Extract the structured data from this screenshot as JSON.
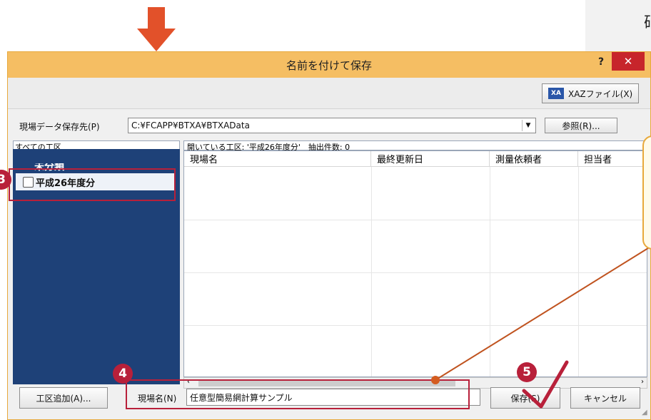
{
  "top_callout_text": "硝",
  "dialog": {
    "title": "名前を付けて保存",
    "help_label": "?",
    "close_label": "✕",
    "xaz_button_label": "XAZファイル(X)",
    "xaz_icon_text": "XA",
    "save_path_label": "現場データ保存先(P)",
    "save_path_value": "C:¥FCAPP¥BTXA¥BTXAData",
    "browse_button_label": "参照(R)...",
    "tree_header": "すべての工区",
    "tree_items": [
      {
        "label": "未分類"
      },
      {
        "label": "平成26年度分"
      }
    ],
    "list_status": "開いている工区: '平成26年度分'　抽出件数: 0",
    "columns": [
      "現場名",
      "最終更新日",
      "測量依頼者",
      "担当者"
    ],
    "add_section_button_label": "工区追加(A)...",
    "site_name_label": "現場名(N)",
    "site_name_value": "任意型簡易網計算サンプル",
    "save_button_label": "保存(S)",
    "cancel_button_label": "キャンセル"
  },
  "steps": {
    "step3": "3",
    "step4": "4",
    "step5": "5"
  },
  "colors": {
    "titlebar": "#f5be63",
    "accent": "#b8203a",
    "tree_bg": "#1e4178",
    "arrow": "#e2512a"
  }
}
